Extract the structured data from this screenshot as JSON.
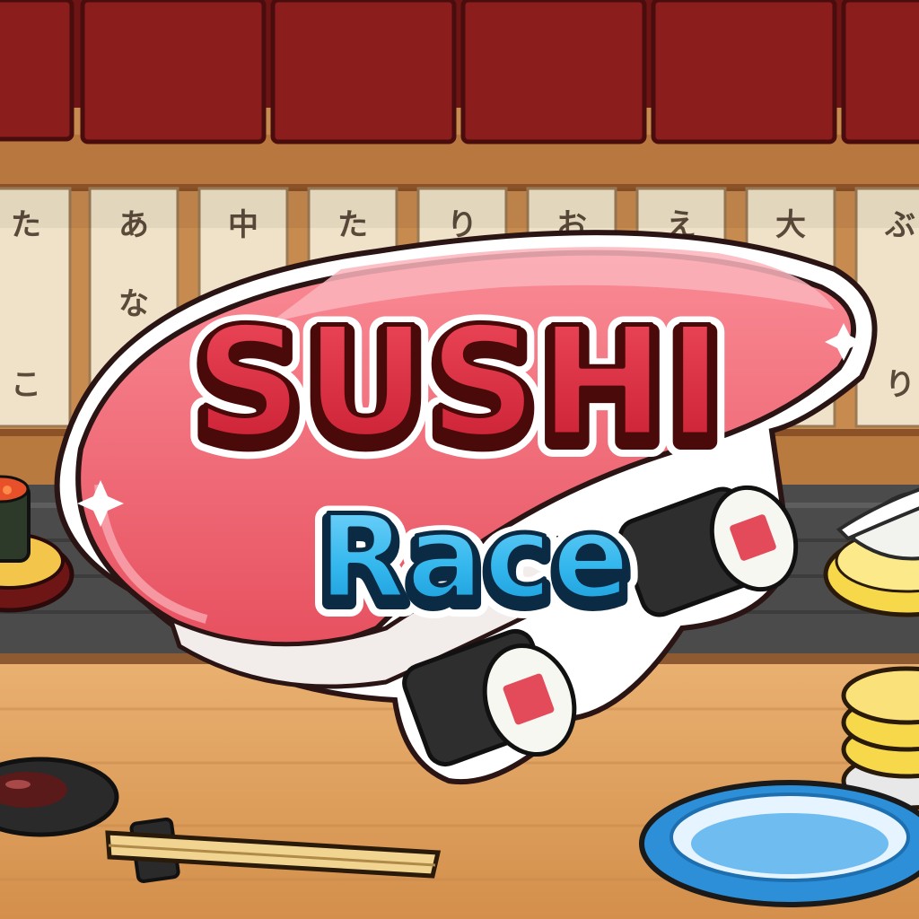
{
  "title": {
    "line1": "SUSHI",
    "line2": "Race"
  },
  "menu": {
    "boards": [
      {
        "top": "た",
        "mid": "",
        "bot": "こ"
      },
      {
        "top": "あ",
        "mid": "な",
        "bot": ""
      },
      {
        "top": "中",
        "mid": "",
        "bot": ""
      },
      {
        "top": "た",
        "mid": "",
        "bot": ""
      },
      {
        "top": "り",
        "mid": "",
        "bot": ""
      },
      {
        "top": "お",
        "mid": "",
        "bot": ""
      },
      {
        "top": "え",
        "mid": "",
        "bot": ""
      },
      {
        "top": "大",
        "mid": "",
        "bot": ""
      },
      {
        "top": "ぶ",
        "mid": "",
        "bot": "り"
      }
    ]
  },
  "colors": {
    "curtain": "#8b1d1d",
    "wood_light": "#e2a866",
    "wood_dark": "#a0602c",
    "tuna": "#ef6b78",
    "title_red": "#d9283c",
    "title_blue": "#35b8ee",
    "plate_blue": "#2c8fd8",
    "plate_yellow": "#f6d84a"
  },
  "icons": [
    "sushi-car-icon",
    "chopsticks-icon",
    "soy-sauce-dish-icon",
    "plate-icon",
    "sushi-plate-icon"
  ]
}
